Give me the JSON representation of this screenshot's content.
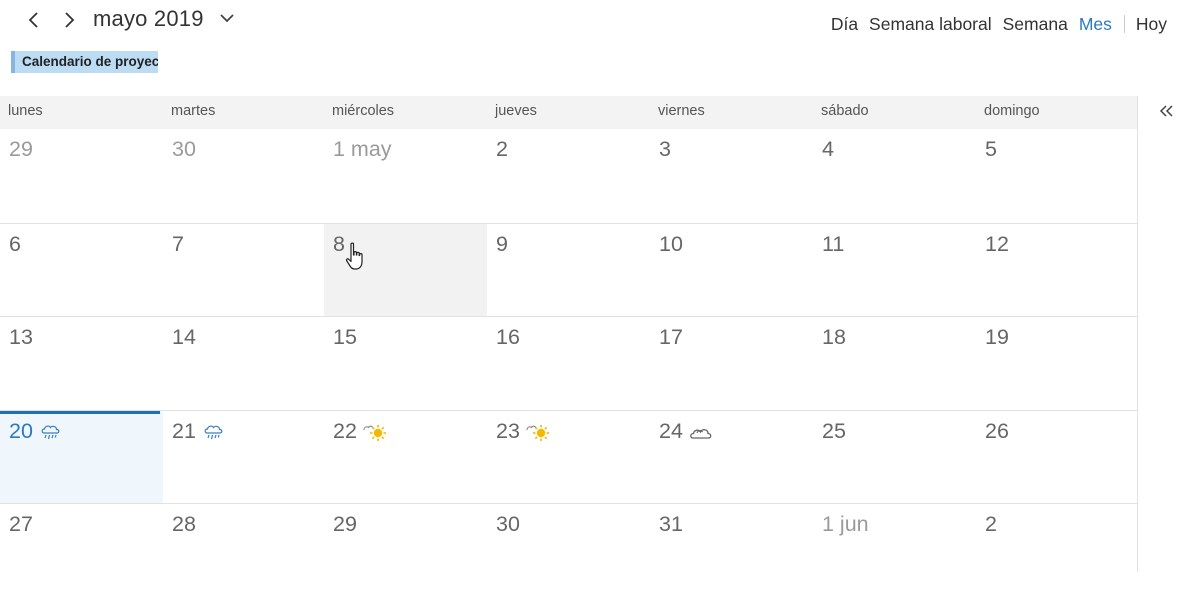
{
  "header": {
    "month_title": "mayo 2019",
    "views": [
      {
        "label": "Día",
        "active": false
      },
      {
        "label": "Semana laboral",
        "active": false
      },
      {
        "label": "Semana",
        "active": false
      },
      {
        "label": "Mes",
        "active": true
      }
    ],
    "today_label": "Hoy",
    "icons": {
      "prev": "chevron-left-icon",
      "next": "chevron-right-icon",
      "month_picker": "chevron-down-icon",
      "collapse": "double-chevron-left-icon"
    }
  },
  "calendar_tag": "Calendario de proyectos",
  "weekdays": [
    "lunes",
    "martes",
    "miércoles",
    "jueves",
    "viernes",
    "sábado",
    "domingo"
  ],
  "weeks": [
    [
      {
        "label": "29",
        "other": true
      },
      {
        "label": "30",
        "other": true
      },
      {
        "label": "1 may",
        "other": true
      },
      {
        "label": "2"
      },
      {
        "label": "3"
      },
      {
        "label": "4"
      },
      {
        "label": "5"
      }
    ],
    [
      {
        "label": "6"
      },
      {
        "label": "7"
      },
      {
        "label": "8",
        "hover": true
      },
      {
        "label": "9"
      },
      {
        "label": "10"
      },
      {
        "label": "11"
      },
      {
        "label": "12"
      }
    ],
    [
      {
        "label": "13"
      },
      {
        "label": "14"
      },
      {
        "label": "15"
      },
      {
        "label": "16"
      },
      {
        "label": "17"
      },
      {
        "label": "18"
      },
      {
        "label": "19"
      }
    ],
    [
      {
        "label": "20",
        "today": true,
        "weather": "rain-icon"
      },
      {
        "label": "21",
        "weather": "rain-icon"
      },
      {
        "label": "22",
        "weather": "partly-sunny-icon"
      },
      {
        "label": "23",
        "weather": "partly-sunny-icon"
      },
      {
        "label": "24",
        "weather": "cloudy-icon"
      },
      {
        "label": "25"
      },
      {
        "label": "26"
      }
    ],
    [
      {
        "label": "27"
      },
      {
        "label": "28"
      },
      {
        "label": "29"
      },
      {
        "label": "30"
      },
      {
        "label": "31"
      },
      {
        "label": "1 jun",
        "other": true
      },
      {
        "label": "2"
      }
    ]
  ],
  "colors": {
    "accent": "#2b79c2",
    "today_bar": "#1f6fb8",
    "tag_bg": "#bcdcf3",
    "sun": "#f5b800"
  }
}
